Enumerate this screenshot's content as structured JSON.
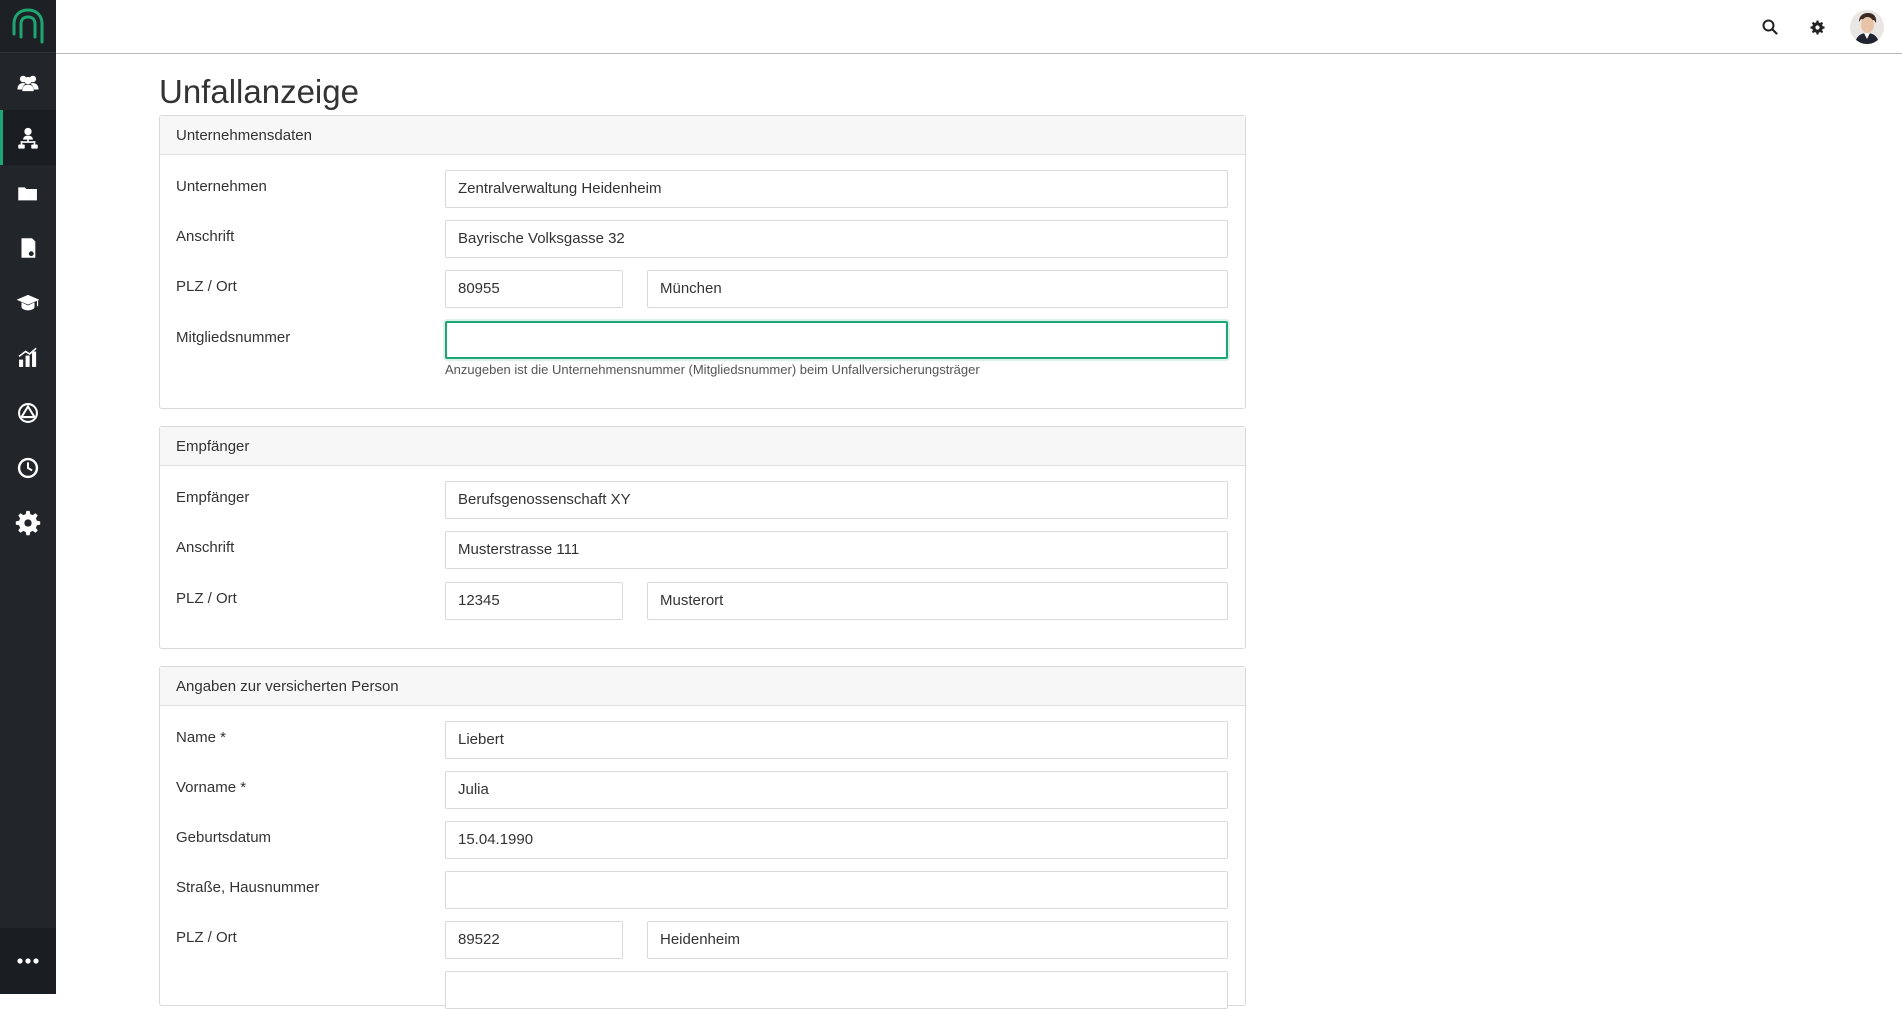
{
  "page": {
    "title": "Unfallanzeige"
  },
  "sidebar": {
    "items": [
      {
        "icon": "users-icon"
      },
      {
        "icon": "org-chart-icon",
        "active": true
      },
      {
        "icon": "folder-icon"
      },
      {
        "icon": "document-search-icon"
      },
      {
        "icon": "graduation-cap-icon"
      },
      {
        "icon": "bar-chart-icon"
      },
      {
        "icon": "hazard-icon"
      },
      {
        "icon": "clock-icon"
      },
      {
        "icon": "gear-icon"
      }
    ],
    "more": "more-icon"
  },
  "topbar": {
    "icons": [
      "search-icon",
      "gear-icon",
      "avatar"
    ]
  },
  "sections": {
    "company": {
      "header": "Unternehmensdaten",
      "company_label": "Unternehmen",
      "company_value": "Zentralverwaltung Heidenheim",
      "address_label": "Anschrift",
      "address_value": "Bayrische Volksgasse 32",
      "zip_label": "PLZ / Ort",
      "zip_value": "80955",
      "city_value": "München",
      "member_label": "Mitgliedsnummer",
      "member_value": "",
      "member_help": "Anzugeben ist die Unternehmensnummer (Mitgliedsnummer) beim Unfallversicherungsträger"
    },
    "recipient": {
      "header": "Empfänger",
      "recipient_label": "Empfänger",
      "recipient_value": "Berufsgenossenschaft XY",
      "address_label": "Anschrift",
      "address_value": "Musterstrasse 111",
      "zip_label": "PLZ / Ort",
      "zip_value": "12345",
      "city_value": "Musterort"
    },
    "person": {
      "header": "Angaben zur versicherten Person",
      "name_label": "Name *",
      "name_value": "Liebert",
      "firstname_label": "Vorname *",
      "firstname_value": "Julia",
      "birth_label": "Geburtsdatum",
      "birth_value": "15.04.1990",
      "street_label": "Straße, Hausnummer",
      "street_value": "",
      "zip_label": "PLZ / Ort",
      "zip_value": "89522",
      "city_value": "Heidenheim"
    }
  },
  "colors": {
    "accent": "#1ea672",
    "sidebar": "#22262b"
  }
}
